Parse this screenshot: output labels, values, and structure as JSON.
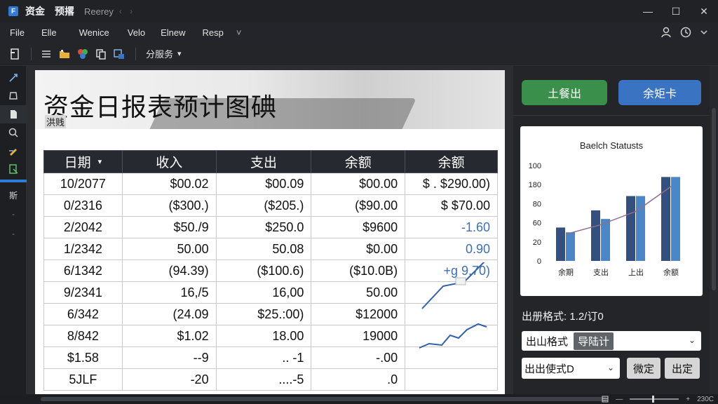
{
  "window": {
    "title": "资金",
    "title2": "预撂",
    "subtitle": "Reerey",
    "nav": "‹ ›",
    "minimize": "—",
    "maximize": "☐",
    "close": "✕"
  },
  "menu": {
    "items": [
      "File",
      "Elle",
      "Wenice",
      "Velo",
      "Elnew",
      "Resp"
    ],
    "more": "˅"
  },
  "toolbar": {
    "label": "分服务",
    "caret": "▾"
  },
  "rail": {
    "text": "斯",
    "dash1": "‑",
    "dash2": "‑"
  },
  "sheet": {
    "title": "资金日报表预计图碘",
    "subtitle": "洪贱"
  },
  "table": {
    "headers": [
      "日期",
      "收入",
      "支出",
      "余额",
      "余额"
    ],
    "header_caret": "▾",
    "rows": [
      [
        "10/2077",
        "$00.02",
        "$00.09",
        "$00.00",
        "$  . $290.00)"
      ],
      [
        "0/2316",
        "($300.)",
        "($205.)",
        "($90.00",
        "$      $70.00"
      ],
      [
        "2/2042",
        "$50./9",
        "$250.0",
        "$9600",
        "-1.60"
      ],
      [
        "1/2342",
        "50.00",
        "50.08",
        "$0.00",
        "0.90"
      ],
      [
        "6/1342",
        "(94.39)",
        "($100.6)",
        "($10.0B)",
        "+g 9.70)"
      ],
      [
        "9/2341",
        "16,/5",
        "16,00",
        "50.00",
        ""
      ],
      [
        "6/342",
        "(24.09",
        "$25.:00)",
        "$12000",
        ""
      ],
      [
        "8/842",
        "$1.02",
        "18.00",
        "19000",
        ""
      ],
      [
        "$1.58",
        "--9",
        "..  -1",
        "-.00",
        ""
      ],
      [
        "5JLF",
        "-20",
        "....-5",
        ".0",
        ""
      ]
    ],
    "neg_cells": [
      [
        2,
        4
      ],
      [
        3,
        4
      ],
      [
        4,
        4
      ]
    ]
  },
  "panel": {
    "btn_primary": "土餐出",
    "btn_secondary": "余矩卡",
    "field_label": "出册格式: 1.2/订0",
    "select_a_label": "出山格式",
    "select_a_chip": "导陆计",
    "select_b_label": "出出使式D",
    "btn_confirm": "微定",
    "btn_cancel": "出定",
    "caret": "⌄"
  },
  "chart_data": {
    "type": "bar",
    "title": "Baelch Statusts",
    "categories": [
      "余期",
      "支出",
      "上出",
      "余额"
    ],
    "ylim": [
      0,
      100
    ],
    "yticks": [
      "0",
      "20",
      "60",
      "80",
      "180",
      "100"
    ],
    "series": [
      {
        "values": [
          35,
          53,
          68,
          88
        ]
      },
      {
        "values": [
          30,
          44,
          68,
          88
        ]
      }
    ],
    "trend": [
      28,
      38,
      52,
      78
    ],
    "colors": {
      "bar_dark": "#34507f",
      "bar_light": "#4a86c8",
      "trend": "#8a6f8f"
    }
  },
  "status": {
    "zoom": "230C"
  }
}
